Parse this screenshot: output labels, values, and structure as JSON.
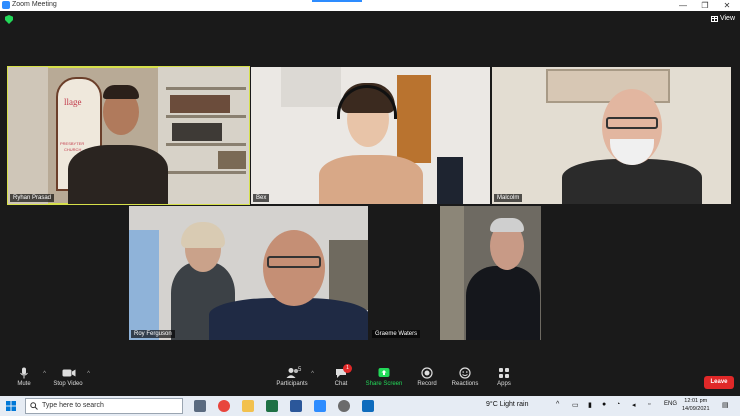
{
  "window": {
    "title": "Zoom Meeting",
    "controls": [
      "—",
      "❐",
      "✕"
    ]
  },
  "view": {
    "label": "View"
  },
  "participants": [
    {
      "name": "Ryhan Prasad",
      "active": true
    },
    {
      "name": "Bex"
    },
    {
      "name": "Malcolm"
    },
    {
      "name": "Roy Ferguson"
    },
    {
      "name": "Graeme Waters"
    }
  ],
  "tile_texts": {
    "church_sign_1": "llage",
    "church_sign_2": "PRESBYTER",
    "church_sign_3": "CHURCH"
  },
  "toolbar": {
    "mute": "Mute",
    "stop_video": "Stop Video",
    "participants": "Participants",
    "participants_count": "5",
    "chat": "Chat",
    "chat_badge": "1",
    "share_screen": "Share Screen",
    "record": "Record",
    "reactions": "Reactions",
    "apps": "Apps",
    "leave": "Leave"
  },
  "taskbar": {
    "search_placeholder": "Type here to search",
    "weather": "9°C  Light rain",
    "language": "ENG",
    "time": "12:01 pm",
    "date": "14/09/2021"
  },
  "colors": {
    "active_border": "#d6e04a",
    "leave": "#e02828",
    "share": "#23d959",
    "accent": "#2d8cff"
  }
}
